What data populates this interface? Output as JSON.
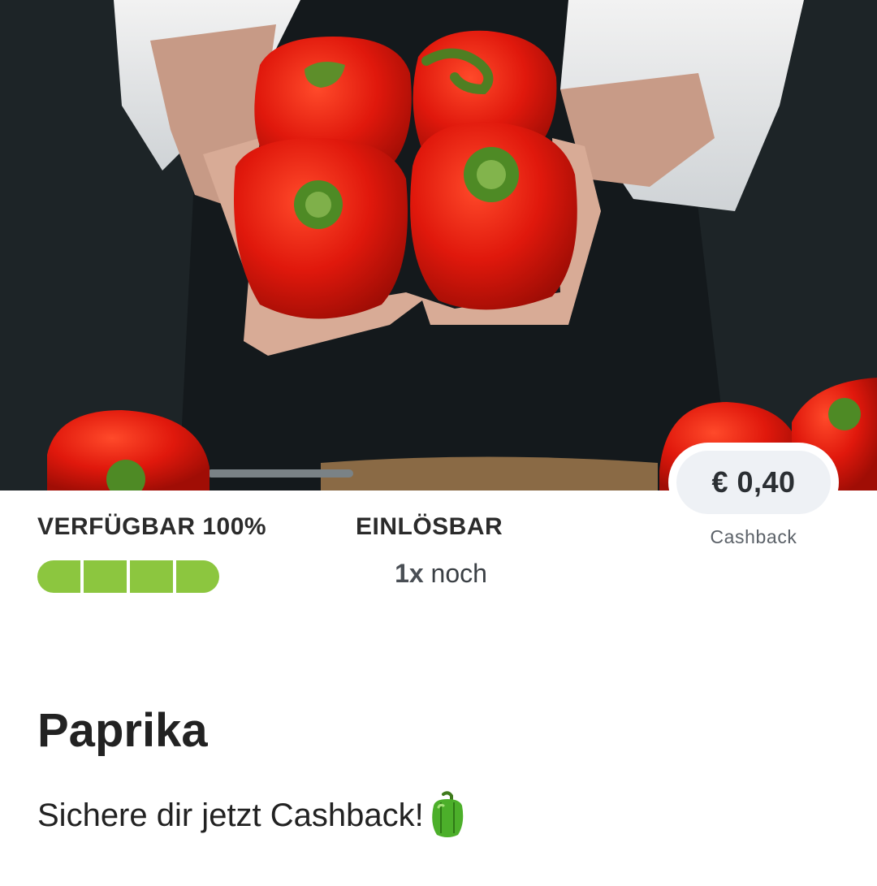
{
  "hero": {
    "image_alt": "Red bell peppers held by chef"
  },
  "cashback": {
    "amount": "€ 0,40",
    "label": "Cashback"
  },
  "availability": {
    "title": "VERFÜGBAR 100%",
    "progress": 1.0,
    "segments": 4,
    "color": "#8cc63f"
  },
  "redeemable": {
    "title": "EINLÖSBAR",
    "count": "1x",
    "suffix": " noch"
  },
  "product": {
    "title": "Paprika",
    "subtitle": "Sichere dir jetzt Cashback!",
    "icon": "green-pepper-icon"
  }
}
